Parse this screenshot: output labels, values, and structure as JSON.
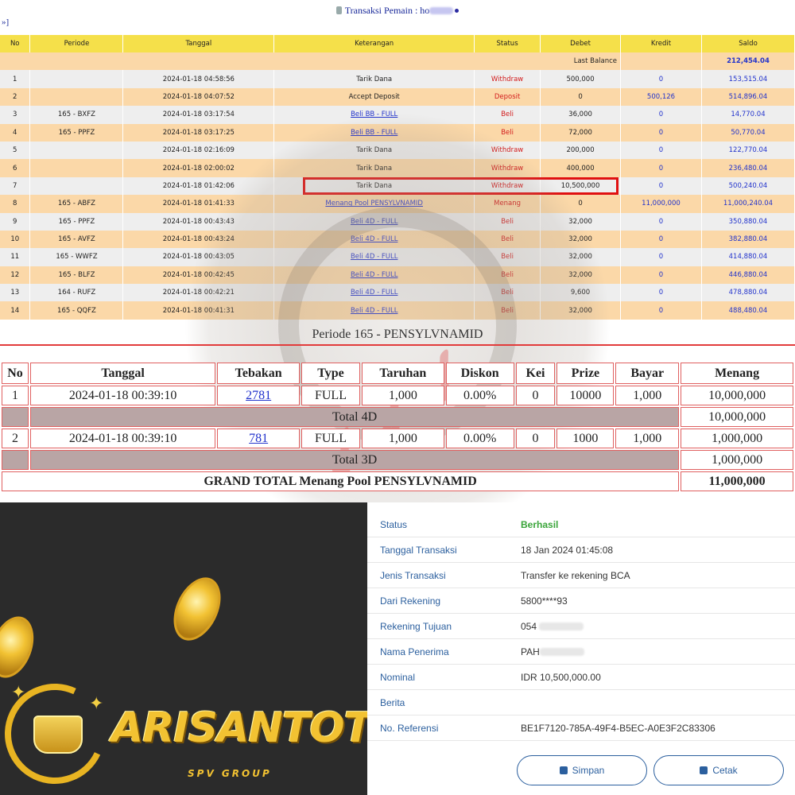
{
  "header": {
    "title_prefix": "Transaksi  Pemain : ho",
    "nav": "»]"
  },
  "tx_table": {
    "columns": [
      "No",
      "Periode",
      "Tanggal",
      "Keterangan",
      "Status",
      "Debet",
      "Kredit",
      "Saldo"
    ],
    "last_balance_label": "Last Balance",
    "last_balance_value": "212,454.04",
    "rows": [
      {
        "no": "1",
        "periode": "",
        "tanggal": "2024-01-18 04:58:56",
        "ket": "Tarik Dana",
        "status": "Withdraw",
        "debet": "500,000",
        "kredit": "0",
        "saldo": "153,515.04",
        "link": false
      },
      {
        "no": "2",
        "periode": "",
        "tanggal": "2024-01-18 04:07:52",
        "ket": "Accept Deposit",
        "status": "Deposit",
        "debet": "0",
        "kredit": "500,126",
        "saldo": "514,896.04",
        "link": false
      },
      {
        "no": "3",
        "periode": "165 - BXFZ",
        "tanggal": "2024-01-18 03:17:54",
        "ket": "Beli BB - FULL",
        "status": "Beli",
        "debet": "36,000",
        "kredit": "0",
        "saldo": "14,770.04",
        "link": true
      },
      {
        "no": "4",
        "periode": "165 - PPFZ",
        "tanggal": "2024-01-18 03:17:25",
        "ket": "Beli BB - FULL",
        "status": "Beli",
        "debet": "72,000",
        "kredit": "0",
        "saldo": "50,770.04",
        "link": true
      },
      {
        "no": "5",
        "periode": "",
        "tanggal": "2024-01-18 02:16:09",
        "ket": "Tarik Dana",
        "status": "Withdraw",
        "debet": "200,000",
        "kredit": "0",
        "saldo": "122,770.04",
        "link": false
      },
      {
        "no": "6",
        "periode": "",
        "tanggal": "2024-01-18 02:00:02",
        "ket": "Tarik Dana",
        "status": "Withdraw",
        "debet": "400,000",
        "kredit": "0",
        "saldo": "236,480.04",
        "link": false
      },
      {
        "no": "7",
        "periode": "",
        "tanggal": "2024-01-18 01:42:06",
        "ket": "Tarik Dana",
        "status": "Withdraw",
        "debet": "10,500,000",
        "kredit": "0",
        "saldo": "500,240.04",
        "link": false
      },
      {
        "no": "8",
        "periode": "165 - ABFZ",
        "tanggal": "2024-01-18 01:41:33",
        "ket": "Menang Pool PENSYLVNAMID",
        "status": "Menang",
        "debet": "0",
        "kredit": "11,000,000",
        "saldo": "11,000,240.04",
        "link": true
      },
      {
        "no": "9",
        "periode": "165 - PPFZ",
        "tanggal": "2024-01-18 00:43:43",
        "ket": "Beli 4D - FULL",
        "status": "Beli",
        "debet": "32,000",
        "kredit": "0",
        "saldo": "350,880.04",
        "link": true
      },
      {
        "no": "10",
        "periode": "165 - AVFZ",
        "tanggal": "2024-01-18 00:43:24",
        "ket": "Beli 4D - FULL",
        "status": "Beli",
        "debet": "32,000",
        "kredit": "0",
        "saldo": "382,880.04",
        "link": true
      },
      {
        "no": "11",
        "periode": "165 - WWFZ",
        "tanggal": "2024-01-18 00:43:05",
        "ket": "Beli 4D - FULL",
        "status": "Beli",
        "debet": "32,000",
        "kredit": "0",
        "saldo": "414,880.04",
        "link": true
      },
      {
        "no": "12",
        "periode": "165 - BLFZ",
        "tanggal": "2024-01-18 00:42:45",
        "ket": "Beli 4D - FULL",
        "status": "Beli",
        "debet": "32,000",
        "kredit": "0",
        "saldo": "446,880.04",
        "link": true
      },
      {
        "no": "13",
        "periode": "164 - RUFZ",
        "tanggal": "2024-01-18 00:42:21",
        "ket": "Beli 4D - FULL",
        "status": "Beli",
        "debet": "9,600",
        "kredit": "0",
        "saldo": "478,880.04",
        "link": true
      },
      {
        "no": "14",
        "periode": "165 - QQFZ",
        "tanggal": "2024-01-18 00:41:31",
        "ket": "Beli 4D - FULL",
        "status": "Beli",
        "debet": "32,000",
        "kredit": "0",
        "saldo": "488,480.04",
        "link": true
      }
    ]
  },
  "periode": {
    "title": "Periode 165 - PENSYLVNAMID",
    "columns": [
      "No",
      "Tanggal",
      "Tebakan",
      "Type",
      "Taruhan",
      "Diskon",
      "Kei",
      "Prize",
      "Bayar",
      "Menang"
    ],
    "row1": {
      "no": "1",
      "tanggal": "2024-01-18 00:39:10",
      "tebakan": "2781",
      "type": "FULL",
      "taruhan": "1,000",
      "diskon": "0.00%",
      "kei": "0",
      "prize": "10000",
      "bayar": "1,000",
      "menang": "10,000,000"
    },
    "total1_label": "Total 4D",
    "total1_value": "10,000,000",
    "row2": {
      "no": "2",
      "tanggal": "2024-01-18 00:39:10",
      "tebakan": "781",
      "type": "FULL",
      "taruhan": "1,000",
      "diskon": "0.00%",
      "kei": "0",
      "prize": "1000",
      "bayar": "1,000",
      "menang": "1,000,000"
    },
    "total2_label": "Total 3D",
    "total2_value": "1,000,000",
    "grand_label": "GRAND TOTAL  Menang Pool PENSYLVNAMID",
    "grand_value": "11,000,000"
  },
  "promo": {
    "brand": "ARISANTOTO",
    "sub": "SPV GROUP"
  },
  "receipt": {
    "status_label": "Status",
    "status_value": "Berhasil",
    "tanggal_label": "Tanggal Transaksi",
    "tanggal_value": "18 Jan 2024 01:45:08",
    "jenis_label": "Jenis Transaksi",
    "jenis_value": "Transfer ke rekening BCA",
    "dari_label": "Dari Rekening",
    "dari_value": "5800****93",
    "tujuan_label": "Rekening Tujuan",
    "tujuan_value": "054",
    "nama_label": "Nama Penerima",
    "nama_value": "PAH",
    "nominal_label": "Nominal",
    "nominal_value": "IDR 10,500,000.00",
    "berita_label": "Berita",
    "berita_value": "",
    "ref_label": "No. Referensi",
    "ref_value": "BE1F7120-785A-49F4-B5EC-A0E3F2C83306",
    "simpan_label": "Simpan",
    "cetak_label": "Cetak"
  }
}
